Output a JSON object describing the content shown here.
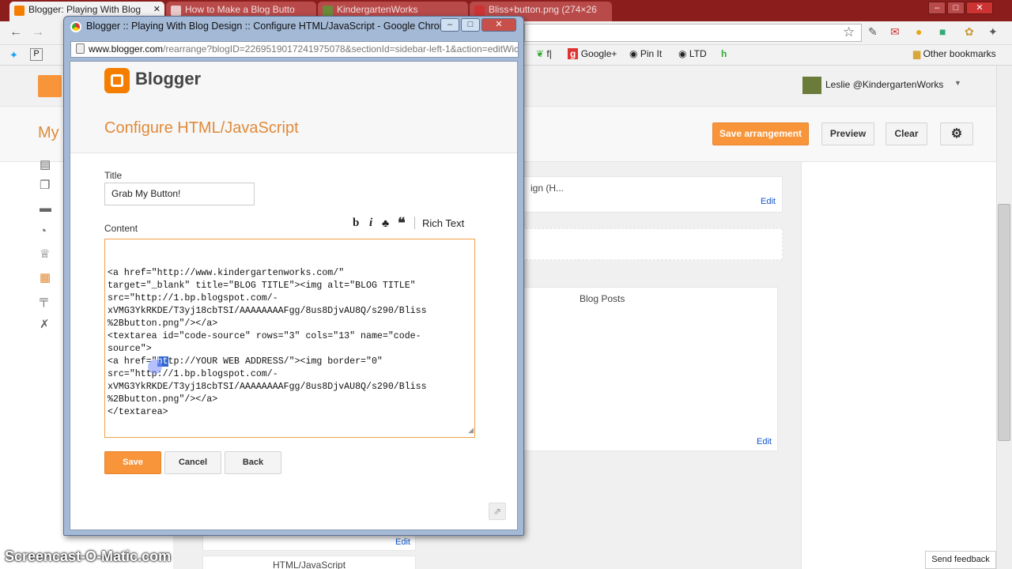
{
  "browser": {
    "tabs": [
      {
        "label": "Blogger: Playing With Blog"
      },
      {
        "label": "How to Make a Blog Butto"
      },
      {
        "label": "KindergartenWorks"
      },
      {
        "label": "Bliss+button.png (274×26"
      }
    ],
    "bookmarks": [
      "f|",
      "Google+",
      "Pin It",
      "LTD",
      "Other bookmarks"
    ]
  },
  "blogger": {
    "user": "Leslie @KindergartenWorks",
    "page_title_partial": "My",
    "save_arrangement": "Save arrangement",
    "preview": "Preview",
    "clear": "Clear",
    "gadget_top_label": "ign (H...",
    "blog_posts_label": "Blog Posts",
    "html_js_label": "HTML/JavaScript",
    "edit": "Edit",
    "send_feedback": "Send feedback"
  },
  "popup": {
    "window_title": "Blogger :: Playing With Blog Design :: Configure HTML/JavaScript - Google Chrome",
    "url_host": "www.blogger.com",
    "url_path": "/rearrange?blogID=2269519017241975078&sectionId=sidebar-left-1&action=editWic",
    "brand": "Blogger",
    "heading": "Configure HTML/JavaScript",
    "title_label": "Title",
    "title_value": "Grab My Button!",
    "content_label": "Content",
    "rich_text": "Rich Text",
    "content_lines": [
      "<a href=\"http://www.kindergartenworks.com/\"",
      "target=\"_blank\" title=\"BLOG TITLE\"><img alt=\"BLOG TITLE\"",
      "src=\"http://1.bp.blogspot.com/-",
      "xVMG3YkRKDE/T3yj18cbTSI/AAAAAAAAFgg/8us8DjvAU8Q/s290/Bliss",
      "%2Bbutton.png\"/></a>",
      "<textarea id=\"code-source\" rows=\"3\" cols=\"13\" name=\"code-",
      "source\">",
      "<a href=\"http://YOUR WEB ADDRESS/\"><img border=\"0\"",
      "src=\"http://1.bp.blogspot.com/-",
      "xVMG3YkRKDE/T3yj18cbTSI/AAAAAAAAFgg/8us8DjvAU8Q/s290/Bliss",
      "%2Bbutton.png\"/></a>",
      "</textarea>"
    ],
    "line8_pre": "<a href=\"",
    "line8_sel": "ht",
    "line8_post": "tp://YOUR WEB ADDRESS/\"><img border=\"0\"",
    "save": "Save",
    "cancel": "Cancel",
    "back": "Back"
  },
  "watermark": "Screencast-O-Matic.com"
}
